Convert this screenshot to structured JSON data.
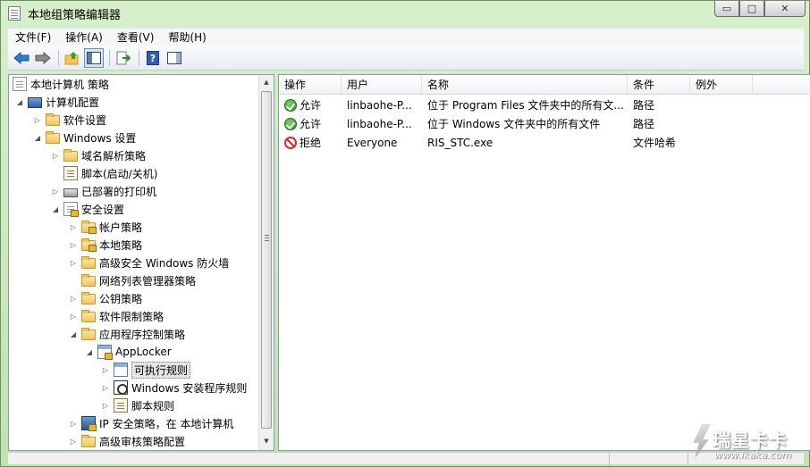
{
  "window": {
    "title": "本地组策略编辑器",
    "min_glyph": "▭",
    "max_glyph": "□",
    "close_glyph": "✕"
  },
  "menu": [
    "文件(F)",
    "操作(A)",
    "查看(V)",
    "帮助(H)"
  ],
  "toolbar": {
    "icons": [
      "back-arrow-icon",
      "forward-arrow-icon",
      "up-folder-icon",
      "show-hide-tree-icon",
      "export-list-icon",
      "help-icon",
      "action-pane-icon"
    ]
  },
  "tree": {
    "items": [
      {
        "label": "本地计算机 策略",
        "icon": "policy-doc-icon",
        "arrow": ""
      },
      {
        "label": "计算机配置",
        "icon": "computer-icon",
        "arrow": "◢"
      },
      {
        "label": "软件设置",
        "icon": "folder-icon",
        "arrow": "▷"
      },
      {
        "label": "Windows 设置",
        "icon": "folder-icon",
        "arrow": "◢"
      },
      {
        "label": "域名解析策略",
        "icon": "folder-icon",
        "arrow": "▷"
      },
      {
        "label": "脚本(启动/关机)",
        "icon": "script-doc-icon",
        "arrow": ""
      },
      {
        "label": "已部署的打印机",
        "icon": "printer-icon",
        "arrow": "▷"
      },
      {
        "label": "安全设置",
        "icon": "security-settings-icon",
        "arrow": "◢"
      },
      {
        "label": "帐户策略",
        "icon": "folder-lock-icon",
        "arrow": "▷"
      },
      {
        "label": "本地策略",
        "icon": "folder-lock-icon",
        "arrow": "▷"
      },
      {
        "label": "高级安全 Windows 防火墙",
        "icon": "folder-icon",
        "arrow": "▷"
      },
      {
        "label": "网络列表管理器策略",
        "icon": "folder-icon",
        "arrow": ""
      },
      {
        "label": "公钥策略",
        "icon": "folder-icon",
        "arrow": "▷"
      },
      {
        "label": "软件限制策略",
        "icon": "folder-icon",
        "arrow": "▷"
      },
      {
        "label": "应用程序控制策略",
        "icon": "folder-icon",
        "arrow": "◢"
      },
      {
        "label": "AppLocker",
        "icon": "applocker-icon",
        "arrow": "◢"
      },
      {
        "label": "可执行规则",
        "icon": "executable-rules-icon",
        "arrow": "▷"
      },
      {
        "label": "Windows 安装程序规则",
        "icon": "installer-rules-icon",
        "arrow": "▷"
      },
      {
        "label": "脚本规则",
        "icon": "script-rules-icon",
        "arrow": "▷"
      },
      {
        "label": "IP 安全策略，在 本地计算机",
        "icon": "ipsec-icon",
        "arrow": "▷"
      },
      {
        "label": "高级审核策略配置",
        "icon": "folder-icon",
        "arrow": "▷"
      }
    ]
  },
  "scroll": {
    "up": "▲",
    "down": "▼"
  },
  "table": {
    "columns": [
      "操作",
      "用户",
      "名称",
      "条件",
      "例外"
    ],
    "rows": [
      {
        "action": "允许",
        "status": "allow",
        "user": "linbaohe-P...",
        "name": "位于 Program Files 文件夹中的所有文...",
        "condition": "路径",
        "exception": ""
      },
      {
        "action": "允许",
        "status": "allow",
        "user": "linbaohe-P...",
        "name": "位于 Windows 文件夹中的所有文件",
        "condition": "路径",
        "exception": ""
      },
      {
        "action": "拒绝",
        "status": "deny",
        "user": "Everyone",
        "name": "RIS_STC.exe",
        "condition": "文件哈希",
        "exception": ""
      }
    ]
  },
  "watermark": {
    "text": "瑞星卡卡",
    "url": "www.ikaka.com"
  }
}
